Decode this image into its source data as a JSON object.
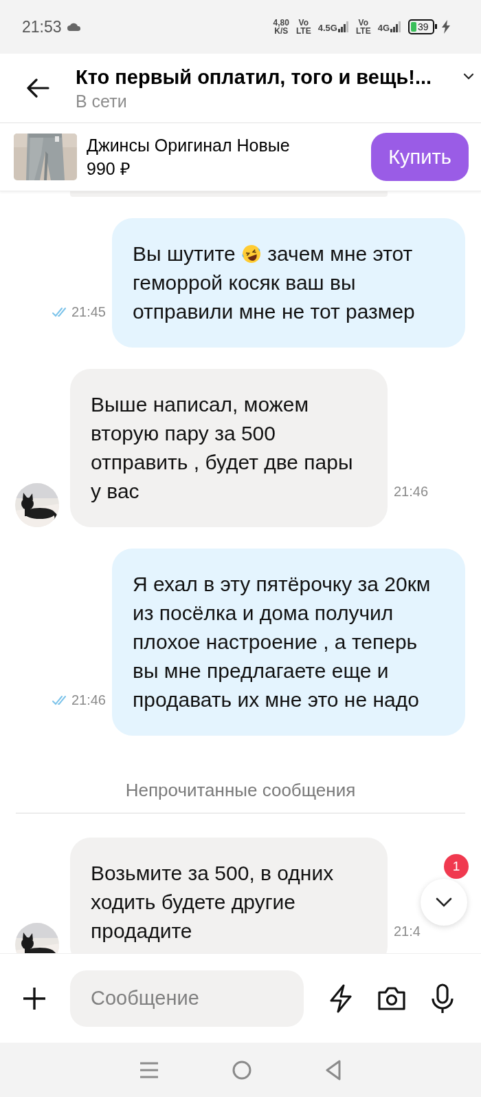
{
  "status_bar": {
    "time": "21:53",
    "speed": "4,80",
    "speed_unit": "K/S",
    "sims": [
      {
        "volte_top": "Vo",
        "volte_bottom": "LTE",
        "network": "4.5G"
      },
      {
        "volte_top": "Vo",
        "volte_bottom": "LTE",
        "network": "4G"
      }
    ],
    "battery": "39"
  },
  "header": {
    "title": "Кто первый оплатил, того и вещь!...",
    "status": "В сети"
  },
  "listing": {
    "title": "Джинсы Оригинал Новые",
    "price": "990 ₽",
    "buy_button": "Купить"
  },
  "messages": [
    {
      "kind": "partial"
    },
    {
      "kind": "outgoing",
      "parts": [
        {
          "kind": "text",
          "text": "Вы шутите"
        },
        {
          "kind": "emoji"
        },
        {
          "kind": "text",
          "text": "зачем мне этот геморрой косяк ваш вы отправили мне не тот размер"
        }
      ],
      "time": "21:45",
      "read": true
    },
    {
      "kind": "incoming",
      "parts": [
        {
          "kind": "text",
          "text": "Выше написал, можем вторую пару за 500 отправить , будет две пары у вас"
        }
      ],
      "time": "21:46"
    },
    {
      "kind": "outgoing",
      "parts": [
        {
          "kind": "text",
          "text": "Я ехал в эту пятёрочку за 20км из посёлка и дома получил плохое настроение , а теперь вы мне предлагаете еще и продавать их мне это не надо"
        }
      ],
      "time": "21:46",
      "read": true
    },
    {
      "kind": "divider",
      "text": "Непрочитанные сообщения"
    },
    {
      "kind": "incoming",
      "parts": [
        {
          "kind": "text",
          "text": "Возьмите за 500, в одних ходить будете другие продадите"
        }
      ],
      "time": "21:4"
    }
  ],
  "scroll_button": {
    "badge": "1"
  },
  "composer": {
    "placeholder": "Сообщение"
  }
}
